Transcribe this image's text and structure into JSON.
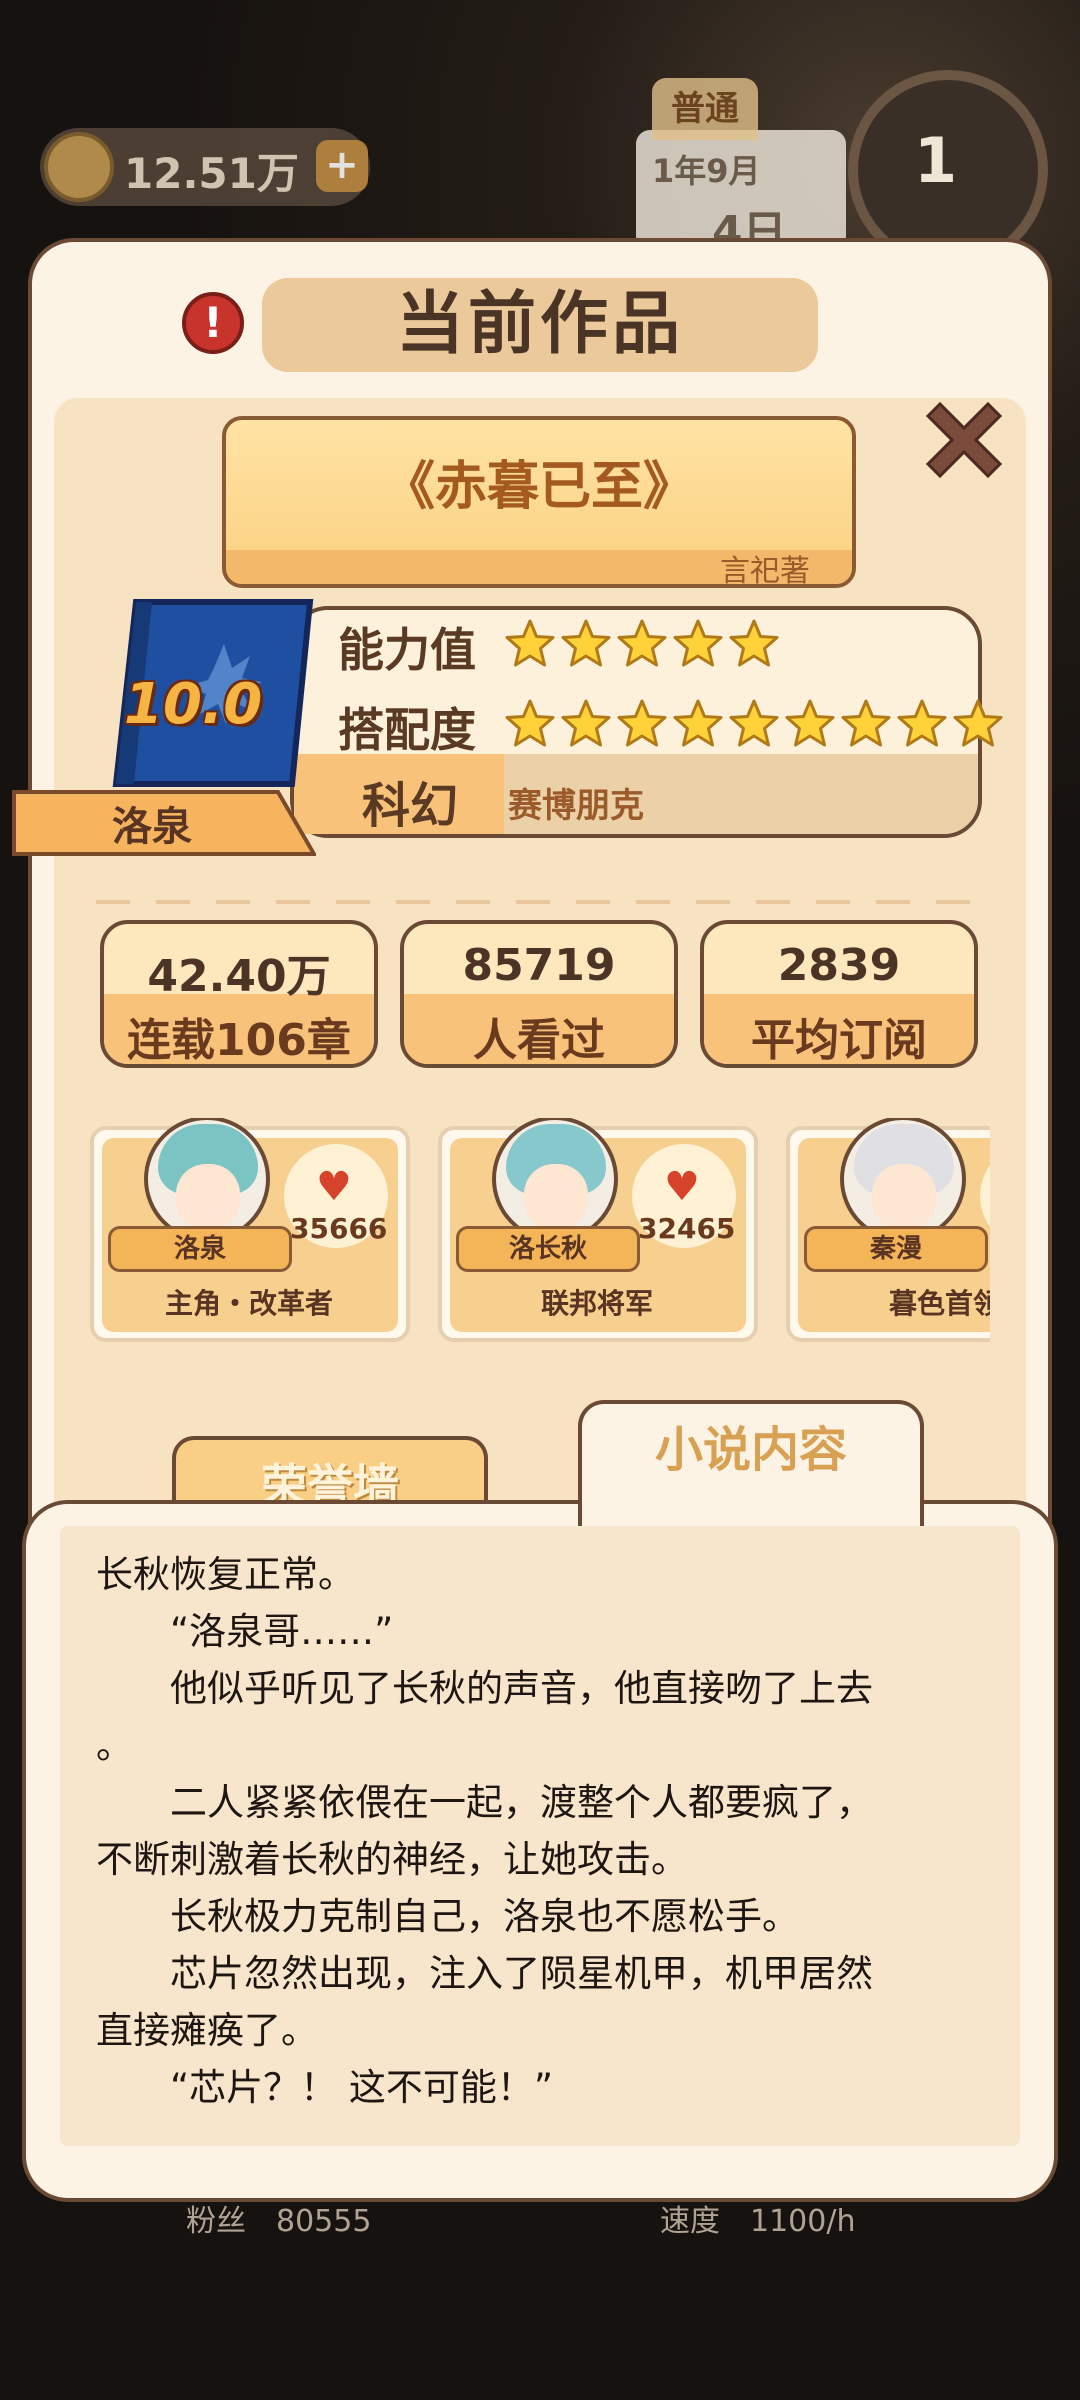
{
  "background": {
    "coins": "12.51万",
    "plus": "+",
    "mode_tab": "普通",
    "calendar_date": "1年9月",
    "calendar_day": "4日",
    "clock_value": "1",
    "bottom_stat_fans_label": "粉丝",
    "bottom_stat_fans_value": "80555",
    "bottom_stat_speed_label": "速度",
    "bottom_stat_speed_value": "1100/h"
  },
  "panel": {
    "alert_icon": "!",
    "title": "当前作品",
    "close_icon": "close-x"
  },
  "book": {
    "title": "《赤暮已至》",
    "author": "言祀著",
    "score": "10.0",
    "protagonist": "洛泉",
    "ability_label": "能力值",
    "ability_stars": 5,
    "match_label": "搭配度",
    "match_stars": 9,
    "genre": "科幻",
    "subgenre": "赛博朋克"
  },
  "metrics": [
    {
      "value": "42.40万",
      "label": "连载106章"
    },
    {
      "value": "85719",
      "label": "人看过"
    },
    {
      "value": "2839",
      "label": "平均订阅"
    }
  ],
  "characters": [
    {
      "name": "洛泉",
      "role": "主角・改革者",
      "likes": "35666",
      "hair": "#7cc4c4"
    },
    {
      "name": "洛长秋",
      "role": "联邦将军",
      "likes": "32465",
      "hair": "#86c8cc"
    },
    {
      "name": "秦漫",
      "role": "暮色首领",
      "likes": "",
      "hair": "#e0e0e4"
    }
  ],
  "tabs": {
    "honor": "荣誉墙",
    "content": "小说内容"
  },
  "novel_text": [
    "长秋恢复正常。",
    "　　“洛泉哥……”",
    "　　他似乎听见了长秋的声音，他直接吻了上去",
    "。",
    "　　二人紧紧依偎在一起，渡整个人都要疯了，",
    "不断刺激着长秋的神经，让她攻击。",
    "　　长秋极力克制自己，洛泉也不愿松手。",
    "　　芯片忽然出现，注入了陨星机甲，机甲居然",
    "直接瘫痪了。",
    "　　“芯片？！ 这不可能！”"
  ]
}
